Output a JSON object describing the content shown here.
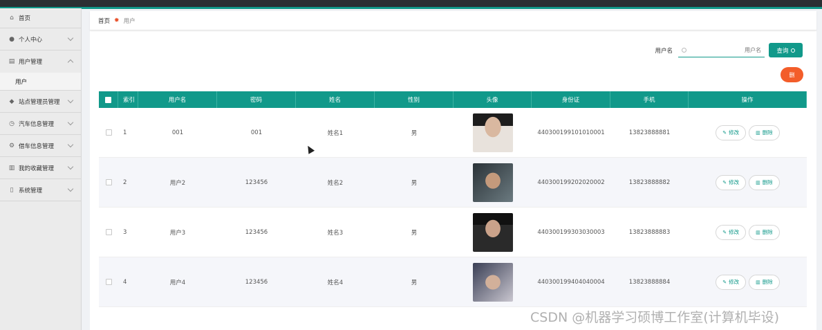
{
  "sidebar": {
    "items": [
      {
        "label": "首页",
        "icon": "home-icon"
      },
      {
        "label": "个人中心",
        "icon": "user-icon"
      },
      {
        "label": "用户管理",
        "icon": "clipboard-icon",
        "sub": [
          "用户"
        ]
      },
      {
        "label": "站点管理员管理",
        "icon": "location-icon"
      },
      {
        "label": "汽车信息管理",
        "icon": "clock-icon"
      },
      {
        "label": "借车信息管理",
        "icon": "settings-icon"
      },
      {
        "label": "我的收藏管理",
        "icon": "bank-icon"
      },
      {
        "label": "系统管理",
        "icon": "phone-icon"
      }
    ]
  },
  "breadcrumb": {
    "home": "首页",
    "current": "用户"
  },
  "search": {
    "label": "用户名",
    "placeholder": "用户名",
    "button": "查询"
  },
  "delete_button": "删",
  "table": {
    "headers": [
      "索引",
      "用户名",
      "密码",
      "姓名",
      "性别",
      "头像",
      "身份证",
      "手机",
      "操作"
    ],
    "rows": [
      {
        "idx": "1",
        "user": "001",
        "pwd": "001",
        "name": "姓名1",
        "sex": "男",
        "id": "440300199101010001",
        "phone": "13823888881"
      },
      {
        "idx": "2",
        "user": "用户2",
        "pwd": "123456",
        "name": "姓名2",
        "sex": "男",
        "id": "440300199202020002",
        "phone": "13823888882"
      },
      {
        "idx": "3",
        "user": "用户3",
        "pwd": "123456",
        "name": "姓名3",
        "sex": "男",
        "id": "440300199303030003",
        "phone": "13823888883"
      },
      {
        "idx": "4",
        "user": "用户4",
        "pwd": "123456",
        "name": "姓名4",
        "sex": "男",
        "id": "440300199404040004",
        "phone": "13823888884"
      }
    ],
    "edit_label": "修改",
    "delete_label": "删除"
  },
  "watermark": "CSDN @机器学习硕博工作室(计算机毕设)",
  "colors": {
    "accent": "#11998a",
    "danger": "#f35d2a"
  }
}
